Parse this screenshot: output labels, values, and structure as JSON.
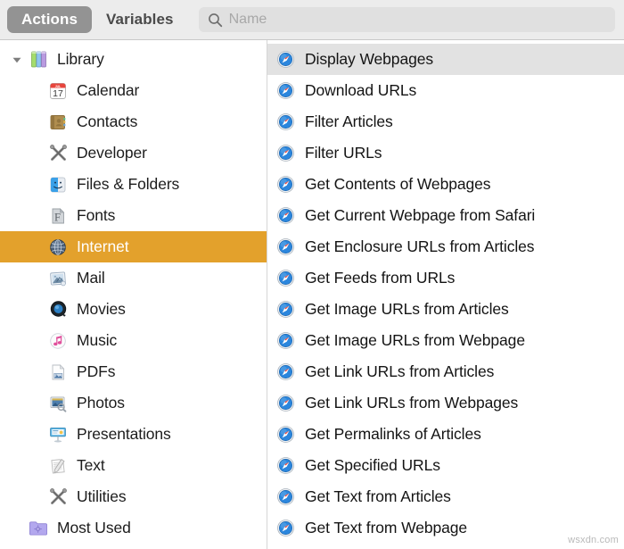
{
  "toolbar": {
    "tabs": [
      {
        "label": "Actions",
        "selected": true
      },
      {
        "label": "Variables",
        "selected": false
      }
    ],
    "search": {
      "placeholder": "Name",
      "value": "",
      "icon": "search-icon"
    }
  },
  "sidebar": {
    "items": [
      {
        "label": "Library",
        "icon": "library-books-icon",
        "level": "root",
        "expanded": true,
        "selected": false
      },
      {
        "label": "Calendar",
        "icon": "calendar-icon",
        "level": "child",
        "selected": false
      },
      {
        "label": "Contacts",
        "icon": "contacts-icon",
        "level": "child",
        "selected": false
      },
      {
        "label": "Developer",
        "icon": "developer-tools-icon",
        "level": "child",
        "selected": false
      },
      {
        "label": "Files & Folders",
        "icon": "finder-icon",
        "level": "child",
        "selected": false
      },
      {
        "label": "Fonts",
        "icon": "fonts-icon",
        "level": "child",
        "selected": false
      },
      {
        "label": "Internet",
        "icon": "internet-globe-icon",
        "level": "child",
        "selected": true
      },
      {
        "label": "Mail",
        "icon": "mail-icon",
        "level": "child",
        "selected": false
      },
      {
        "label": "Movies",
        "icon": "quicktime-icon",
        "level": "child",
        "selected": false
      },
      {
        "label": "Music",
        "icon": "music-note-icon",
        "level": "child",
        "selected": false
      },
      {
        "label": "PDFs",
        "icon": "pdf-document-icon",
        "level": "child",
        "selected": false
      },
      {
        "label": "Photos",
        "icon": "photos-icon",
        "level": "child",
        "selected": false
      },
      {
        "label": "Presentations",
        "icon": "keynote-icon",
        "level": "child",
        "selected": false
      },
      {
        "label": "Text",
        "icon": "textedit-icon",
        "level": "child",
        "selected": false
      },
      {
        "label": "Utilities",
        "icon": "utilities-tools-icon",
        "level": "child",
        "selected": false
      },
      {
        "label": "Most Used",
        "icon": "purple-folder-icon",
        "level": "root-noarrow",
        "selected": false
      }
    ]
  },
  "actions": {
    "items": [
      {
        "label": "Display Webpages",
        "icon": "safari-compass-icon",
        "selected": true
      },
      {
        "label": "Download URLs",
        "icon": "safari-compass-icon",
        "selected": false
      },
      {
        "label": "Filter Articles",
        "icon": "safari-compass-icon",
        "selected": false
      },
      {
        "label": "Filter URLs",
        "icon": "safari-compass-icon",
        "selected": false
      },
      {
        "label": "Get Contents of Webpages",
        "icon": "safari-compass-icon",
        "selected": false
      },
      {
        "label": "Get Current Webpage from Safari",
        "icon": "safari-compass-icon",
        "selected": false
      },
      {
        "label": "Get Enclosure URLs from Articles",
        "icon": "safari-compass-icon",
        "selected": false
      },
      {
        "label": "Get Feeds from URLs",
        "icon": "safari-compass-icon",
        "selected": false
      },
      {
        "label": "Get Image URLs from Articles",
        "icon": "safari-compass-icon",
        "selected": false
      },
      {
        "label": "Get Image URLs from Webpage",
        "icon": "safari-compass-icon",
        "selected": false
      },
      {
        "label": "Get Link URLs from Articles",
        "icon": "safari-compass-icon",
        "selected": false
      },
      {
        "label": "Get Link URLs from Webpages",
        "icon": "safari-compass-icon",
        "selected": false
      },
      {
        "label": "Get Permalinks of Articles",
        "icon": "safari-compass-icon",
        "selected": false
      },
      {
        "label": "Get Specified URLs",
        "icon": "safari-compass-icon",
        "selected": false
      },
      {
        "label": "Get Text from Articles",
        "icon": "safari-compass-icon",
        "selected": false
      },
      {
        "label": "Get Text from Webpage",
        "icon": "safari-compass-icon",
        "selected": false
      }
    ]
  },
  "watermark": {
    "text": "wsxdn.com"
  },
  "colors": {
    "selection_sidebar": "#e3a12c",
    "selection_list": "#e2e2e2",
    "tab_selected_bg": "#939393",
    "toolbar_bg": "#ececec",
    "search_bg": "#e0e0e0"
  }
}
